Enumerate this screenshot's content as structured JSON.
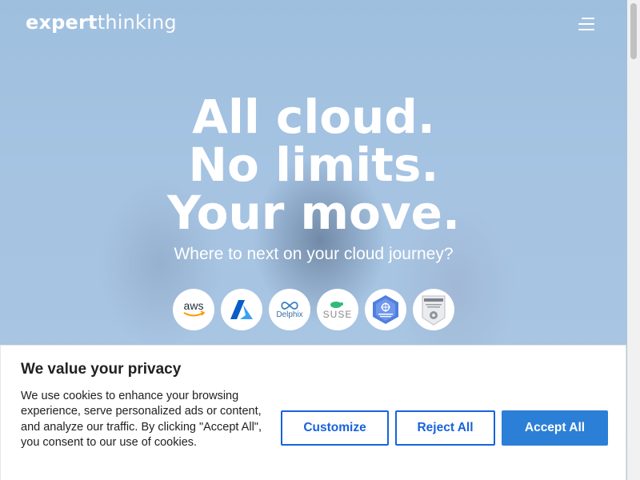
{
  "brand": {
    "logo_bold": "expert",
    "logo_light": "thinking"
  },
  "hero": {
    "lines": [
      "All cloud.",
      "No limits.",
      "Your move."
    ],
    "subtitle": "Where to next on your cloud journey?",
    "partners": [
      {
        "name": "aws",
        "label": "aws"
      },
      {
        "name": "azure",
        "label": ""
      },
      {
        "name": "delphix",
        "label": "Delphix"
      },
      {
        "name": "suse",
        "label": "SUSE"
      },
      {
        "name": "kubernetes-badge",
        "label": ""
      },
      {
        "name": "certification-badge",
        "label": ""
      }
    ]
  },
  "cookie": {
    "title": "We value your privacy",
    "text": "We use cookies to enhance your browsing experience, serve personalized ads or content, and analyze our traffic. By clicking \"Accept All\", you consent to our use of cookies.",
    "customize": "Customize",
    "reject": "Reject All",
    "accept": "Accept All"
  },
  "colors": {
    "primary": "#1863dc",
    "accept_bg": "#2b7fd6",
    "hero_bg": "#a6c4e2"
  }
}
